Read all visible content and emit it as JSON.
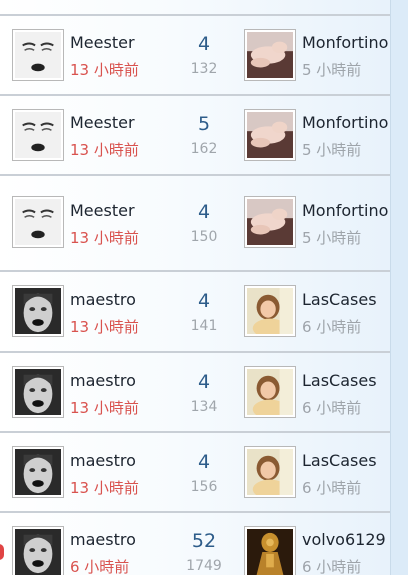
{
  "rows": [
    {
      "left": {
        "name": "Meester",
        "time": "13 小時前",
        "avatar": "face-sketch-icon"
      },
      "count": "4",
      "sub": "132",
      "right": {
        "name": "Monfortino",
        "time": "5 小時前",
        "avatar": "photo-reclining-icon"
      }
    },
    {
      "left": {
        "name": "Meester",
        "time": "13 小時前",
        "avatar": "face-sketch-icon"
      },
      "count": "5",
      "sub": "162",
      "right": {
        "name": "Monfortino",
        "time": "5 小時前",
        "avatar": "photo-reclining-icon"
      }
    },
    {
      "left": {
        "name": "Meester",
        "time": "13 小時前",
        "avatar": "face-sketch-icon"
      },
      "count": "4",
      "sub": "150",
      "right": {
        "name": "Monfortino",
        "time": "5 小時前",
        "avatar": "photo-reclining-icon"
      }
    },
    {
      "left": {
        "name": "maestro",
        "time": "13 小時前",
        "avatar": "face-lips-icon"
      },
      "count": "4",
      "sub": "141",
      "right": {
        "name": "LasCases",
        "time": "6 小時前",
        "avatar": "photo-woman-icon"
      }
    },
    {
      "left": {
        "name": "maestro",
        "time": "13 小時前",
        "avatar": "face-lips-icon"
      },
      "count": "4",
      "sub": "134",
      "right": {
        "name": "LasCases",
        "time": "6 小時前",
        "avatar": "photo-woman-icon"
      }
    },
    {
      "left": {
        "name": "maestro",
        "time": "13 小時前",
        "avatar": "face-lips-icon"
      },
      "count": "4",
      "sub": "156",
      "right": {
        "name": "LasCases",
        "time": "6 小時前",
        "avatar": "photo-woman-icon"
      }
    },
    {
      "left": {
        "name": "maestro",
        "time": "6 小時前",
        "avatar": "face-lips-icon"
      },
      "count": "52",
      "sub": "1749",
      "right": {
        "name": "volvo6129",
        "time": "6 小時前",
        "avatar": "golden-statue-icon"
      }
    }
  ],
  "colors": {
    "left_time": "#d9534f",
    "right_time": "#9ea4aa",
    "count": "#2d5c8a",
    "divider": "#c9cfd6",
    "panel_bg": "#e8f2fb"
  }
}
